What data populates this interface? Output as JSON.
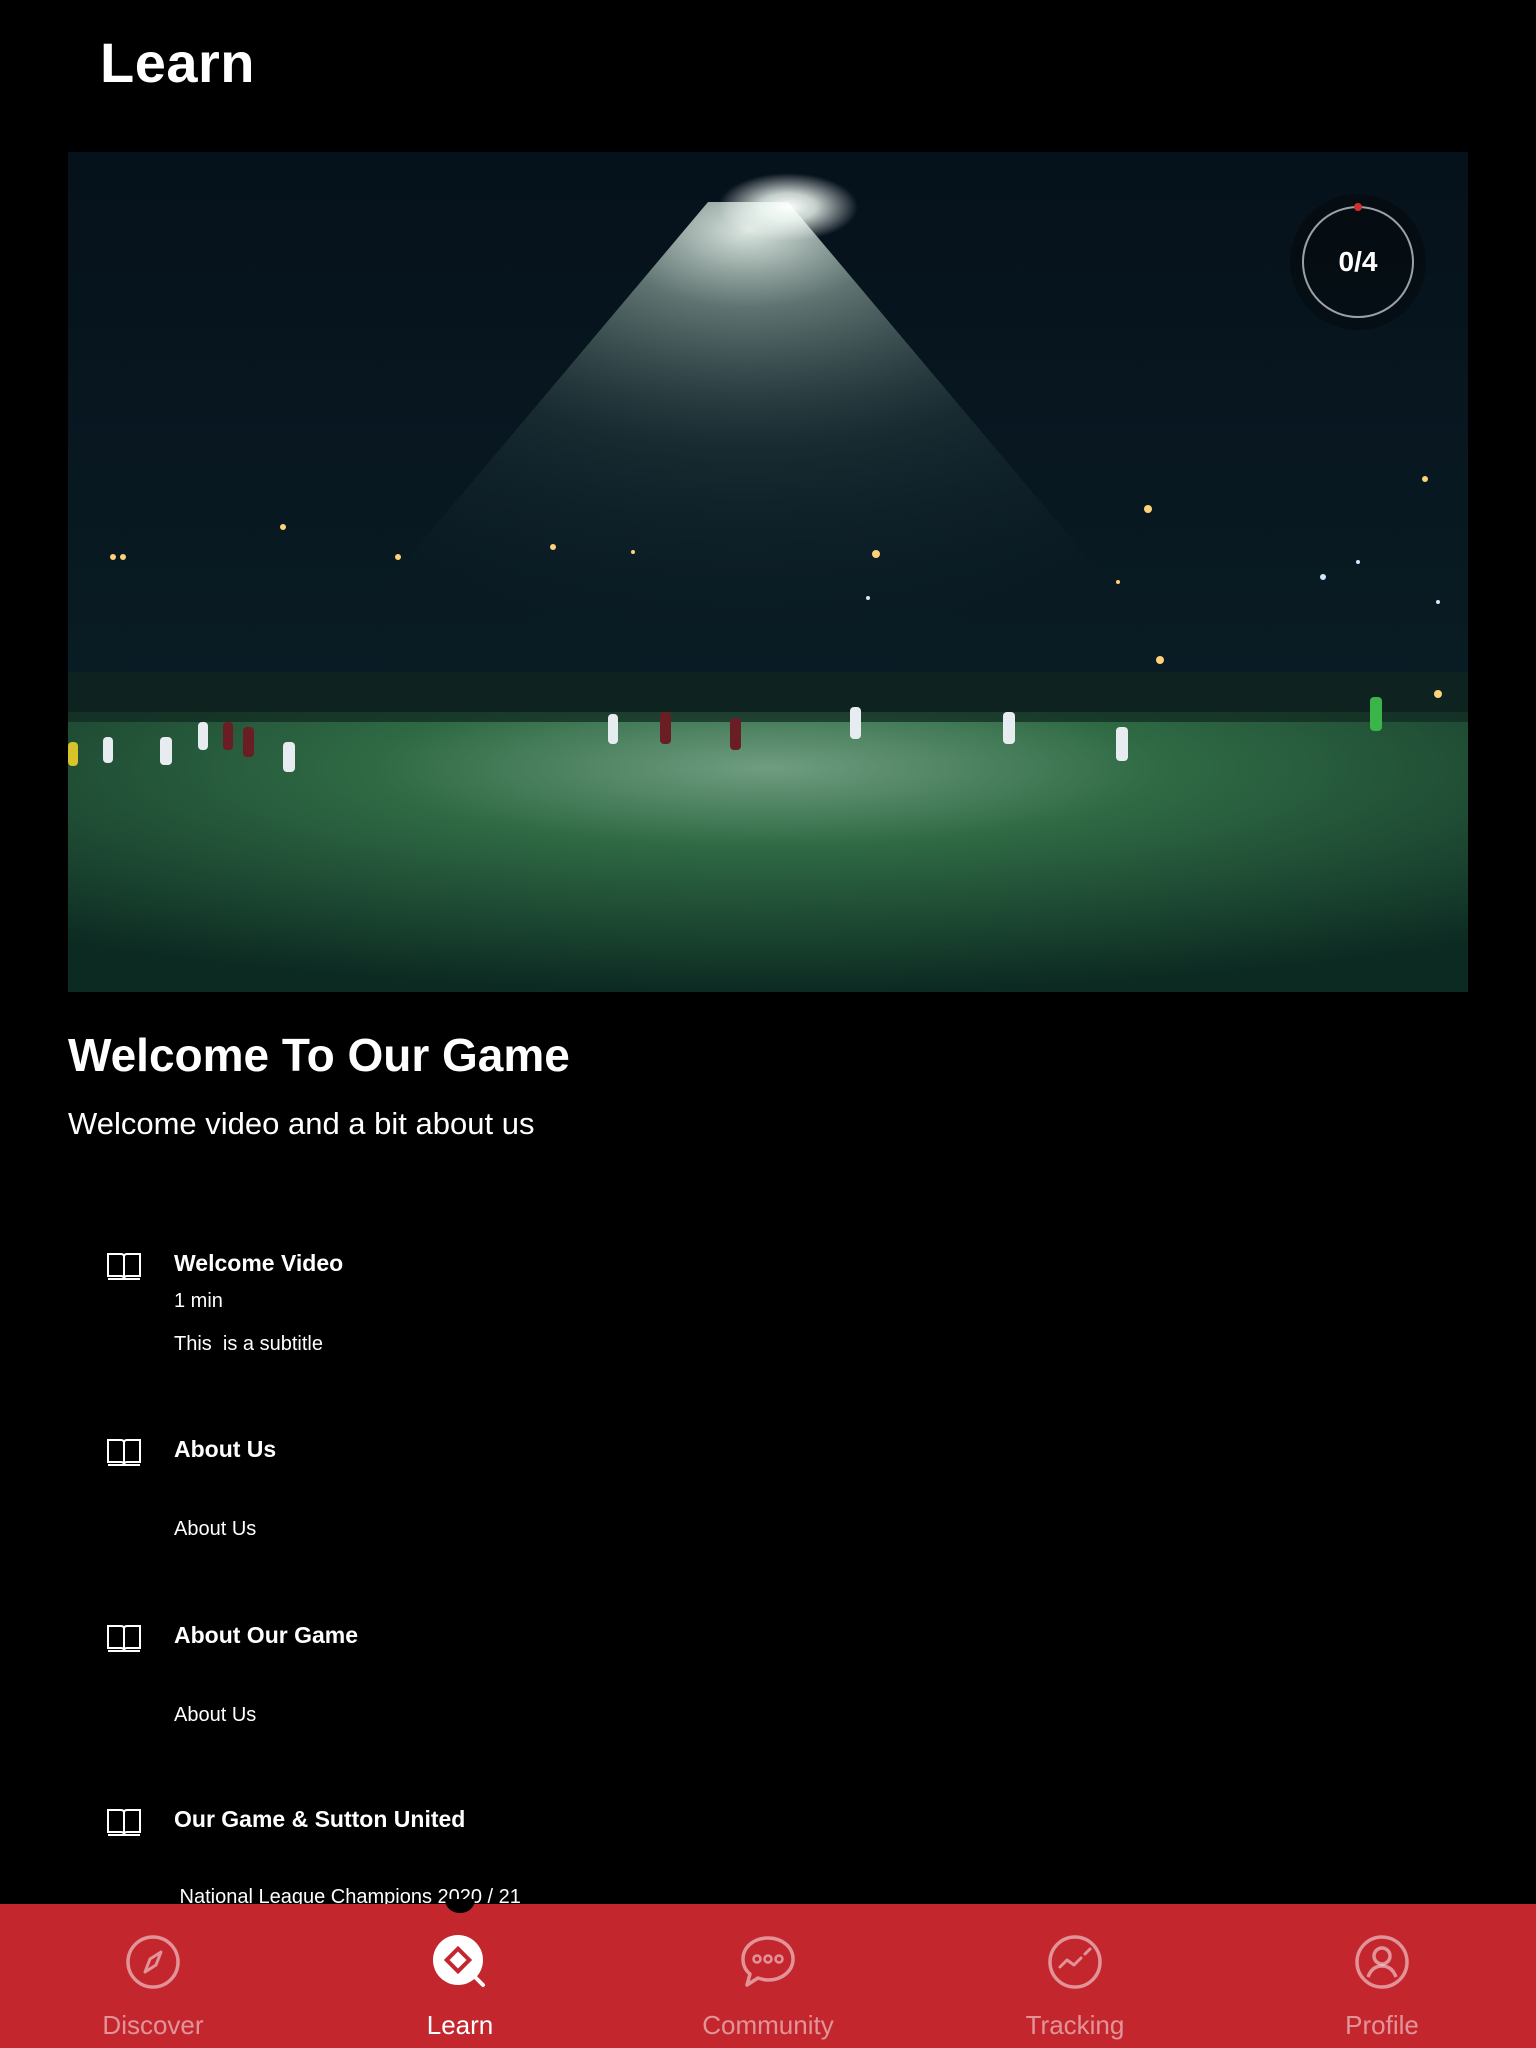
{
  "header": {
    "title": "Learn"
  },
  "hero": {
    "image": "night-football-pitch-floodlight",
    "progress": {
      "completed": 0,
      "total": 4,
      "label": "0/4"
    }
  },
  "module": {
    "title": "Welcome To Our Game",
    "subtitle": "Welcome video and a bit about us"
  },
  "lessons": [
    {
      "icon": "book-icon",
      "title": "Welcome Video",
      "duration": "1 min",
      "description": "This  is a subtitle"
    },
    {
      "icon": "book-icon",
      "title": "About Us",
      "duration": "",
      "description": "About Us"
    },
    {
      "icon": "book-icon",
      "title": "About Our Game",
      "duration": "",
      "description": "About Us"
    },
    {
      "icon": "book-icon",
      "title": "Our Game & Sutton United",
      "duration": "",
      "description": " National League Champions 2020 / 21"
    }
  ],
  "nav": {
    "items": [
      {
        "label": "Discover",
        "icon": "compass-icon",
        "active": false
      },
      {
        "label": "Learn",
        "icon": "learn-search-icon",
        "active": true
      },
      {
        "label": "Community",
        "icon": "chat-bubble-icon",
        "active": false
      },
      {
        "label": "Tracking",
        "icon": "tracking-chart-icon",
        "active": false
      },
      {
        "label": "Profile",
        "icon": "user-icon",
        "active": false
      }
    ]
  },
  "colors": {
    "background": "#000000",
    "nav_background": "#c4262e",
    "progress_accent": "#d32f2f",
    "text": "#ffffff"
  }
}
